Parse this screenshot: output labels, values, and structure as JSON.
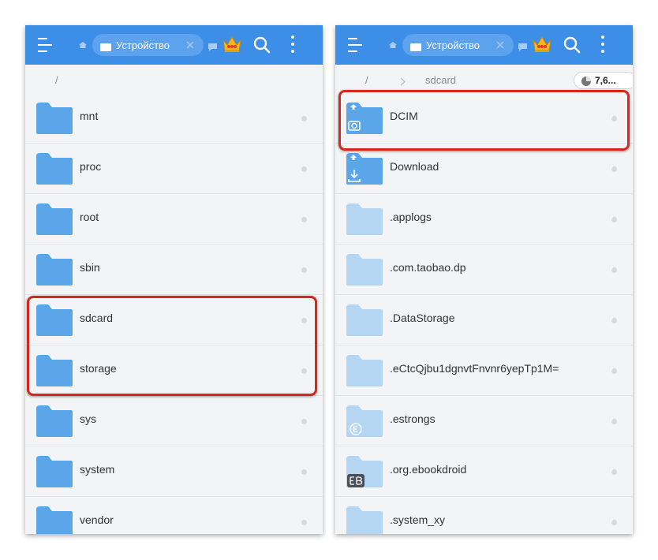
{
  "colors": {
    "topbar": "#3d8ee6",
    "folder": "#5aa6e8",
    "folder_hidden": "#b4d6f3",
    "highlight": "#d9261c"
  },
  "left": {
    "tab_label": "Устройство",
    "path_root": "/",
    "items": [
      {
        "name": "mnt"
      },
      {
        "name": "proc"
      },
      {
        "name": "root"
      },
      {
        "name": "sbin"
      },
      {
        "name": "sdcard"
      },
      {
        "name": "storage"
      },
      {
        "name": "sys"
      },
      {
        "name": "system"
      },
      {
        "name": "vendor"
      }
    ]
  },
  "right": {
    "tab_label": "Устройство",
    "path_root": "/",
    "path_folder": "sdcard",
    "storage_badge": "7,6...",
    "items": [
      {
        "name": "DCIM"
      },
      {
        "name": "Download"
      },
      {
        "name": ".applogs"
      },
      {
        "name": ".com.taobao.dp"
      },
      {
        "name": ".DataStorage"
      },
      {
        "name": ".eCtcQjbu1dgnvtFnvnr6yepTp1M="
      },
      {
        "name": ".estrongs"
      },
      {
        "name": ".org.ebookdroid"
      },
      {
        "name": ".system_xy"
      }
    ]
  }
}
